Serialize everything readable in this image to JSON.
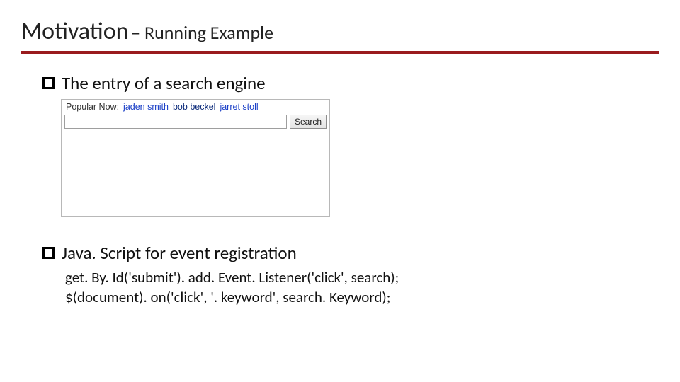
{
  "title": {
    "main": "Motivation",
    "sub": " – Running Example"
  },
  "bullets": {
    "b1": "The entry of a search engine",
    "b2": "Java. Script for event registration"
  },
  "search_shot": {
    "popular_label": "Popular Now:",
    "keywords": [
      "jaden smith",
      "bob beckel",
      "jarret stoll"
    ],
    "button_label": "Search",
    "input_value": ""
  },
  "code": {
    "line1": "get. By. Id('submit'). add. Event. Listener('click', search);",
    "line2": "$(document). on('click', '. keyword', search. Keyword);"
  },
  "colors": {
    "accent": "#9a1b1e",
    "link": "#1a3fc7"
  }
}
